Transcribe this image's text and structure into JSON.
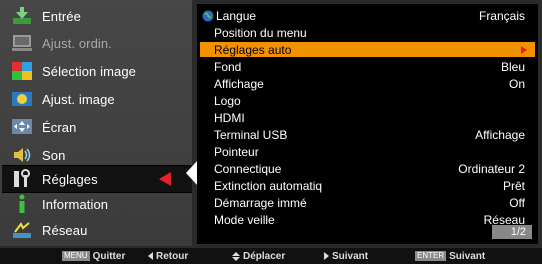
{
  "sidebar": {
    "items": [
      {
        "label": "Entrée",
        "icon": "input-arrow-icon",
        "dim": false
      },
      {
        "label": "Ajust. ordin.",
        "icon": "computer-icon",
        "dim": true
      },
      {
        "label": "Sélection image",
        "icon": "image-select-icon",
        "dim": false
      },
      {
        "label": "Ajust. image",
        "icon": "image-adjust-icon",
        "dim": false
      },
      {
        "label": "Écran",
        "icon": "screen-icon",
        "dim": false
      },
      {
        "label": "Son",
        "icon": "speaker-icon",
        "dim": false
      },
      {
        "label": "Réglages",
        "icon": "wrench-icon",
        "dim": false,
        "selected": true
      },
      {
        "label": "Information",
        "icon": "info-icon",
        "dim": false
      },
      {
        "label": "Réseau",
        "icon": "network-icon",
        "dim": false
      }
    ]
  },
  "settings": {
    "rows": [
      {
        "label": "Langue",
        "value": "Français",
        "icon": "globe-icon"
      },
      {
        "label": "Position du menu",
        "value": ""
      },
      {
        "label": "Réglages auto",
        "value": "",
        "highlighted": true
      },
      {
        "label": "Fond",
        "value": "Bleu"
      },
      {
        "label": "Affichage",
        "value": "On"
      },
      {
        "label": "Logo",
        "value": ""
      },
      {
        "label": "HDMI",
        "value": ""
      },
      {
        "label": "Terminal USB",
        "value": "Affichage"
      },
      {
        "label": "Pointeur",
        "value": ""
      },
      {
        "label": "Connectique",
        "value": "Ordinateur 2"
      },
      {
        "label": "Extinction automatiq",
        "value": "Prêt"
      },
      {
        "label": "Démarrage immé",
        "value": "Off"
      },
      {
        "label": "Mode veille",
        "value": "Réseau"
      }
    ],
    "page": "1/2"
  },
  "footer": {
    "menu_key": "MENU",
    "quit": "Quitter",
    "back": "Retour",
    "move": "Déplacer",
    "next": "Suivant",
    "enter_key": "ENTER",
    "enter_next": "Suivant"
  },
  "colors": {
    "highlight": "#f39200",
    "selection_arrow": "#e8202a"
  }
}
